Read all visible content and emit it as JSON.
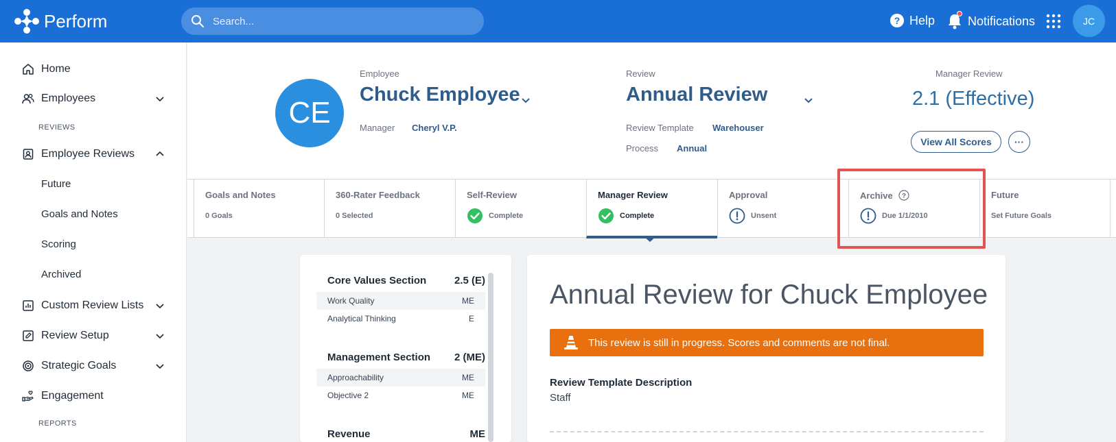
{
  "app": {
    "name": "Perform"
  },
  "search": {
    "placeholder": "Search..."
  },
  "topbar": {
    "help": "Help",
    "notifications": "Notifications",
    "user_initials": "JC"
  },
  "sidebar": {
    "home": "Home",
    "employees": "Employees",
    "reviews_section": "REVIEWS",
    "employee_reviews": "Employee Reviews",
    "sub_items": [
      "Future",
      "Goals and Notes",
      "Scoring",
      "Archived"
    ],
    "custom_review_lists": "Custom Review Lists",
    "review_setup": "Review Setup",
    "strategic_goals": "Strategic Goals",
    "engagement": "Engagement",
    "reports_section": "REPORTS"
  },
  "header": {
    "employee_label": "Employee",
    "employee_initials": "CE",
    "employee_name": "Chuck Employee",
    "manager_label": "Manager",
    "manager_value": "Cheryl V.P.",
    "review_label": "Review",
    "review_name": "Annual Review",
    "template_label": "Review Template",
    "template_value": "Warehouser",
    "process_label": "Process",
    "process_value": "Annual",
    "manager_review_label": "Manager Review",
    "manager_review_score": "2.1 (Effective)",
    "view_all_scores": "View All Scores",
    "more": "···"
  },
  "steps": [
    {
      "title": "Goals and Notes",
      "status": "0 Goals",
      "icon": ""
    },
    {
      "title": "360-Rater Feedback",
      "status": "0 Selected",
      "icon": ""
    },
    {
      "title": "Self-Review",
      "status": "Complete",
      "icon": "check-circle-icon"
    },
    {
      "title": "Manager Review",
      "status": "Complete",
      "icon": "check-circle-icon"
    },
    {
      "title": "Approval",
      "status": "Unsent",
      "icon": "exclamation-circle-icon"
    },
    {
      "title": "Archive",
      "status": "Due 1/1/2010",
      "icon": "exclamation-circle-icon"
    },
    {
      "title": "Future",
      "status": "Set Future Goals",
      "icon": ""
    }
  ],
  "score_panel": {
    "sections": [
      {
        "name": "Core Values Section",
        "score": "2.5 (E)",
        "rows": [
          {
            "name": "Work Quality",
            "rating": "ME"
          },
          {
            "name": "Analytical Thinking",
            "rating": "E"
          }
        ]
      },
      {
        "name": "Management Section",
        "score": "2 (ME)",
        "rows": [
          {
            "name": "Approachability",
            "rating": "ME"
          },
          {
            "name": "Objective 2",
            "rating": "ME"
          }
        ]
      },
      {
        "name": "Revenue",
        "score": "ME",
        "rows": []
      }
    ]
  },
  "main": {
    "title": "Annual Review for Chuck Employee",
    "banner": "This review is still in progress. Scores and comments are not final.",
    "desc_label": "Review Template Description",
    "desc_value": "Staff"
  },
  "colors": {
    "topbar": "#1a6fd6",
    "accent": "#2f5c8a",
    "banner": "#e8700f",
    "success": "#34c060",
    "highlight": "#e05454"
  }
}
